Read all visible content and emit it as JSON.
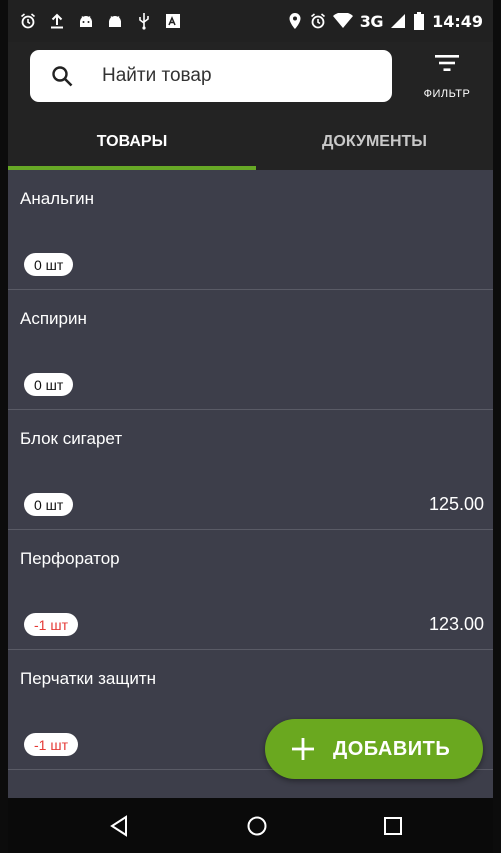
{
  "status_bar": {
    "network": "3G",
    "time": "14:49",
    "left_icons": [
      "alarm-icon",
      "upload-icon",
      "android-icon",
      "android-icon",
      "usb-icon",
      "image-icon"
    ],
    "right_icons": [
      "location-icon",
      "alarm-icon",
      "wifi-icon",
      "network-label",
      "signal-icon",
      "battery-icon",
      "time"
    ]
  },
  "header": {
    "search": {
      "placeholder": "Найти товар",
      "value": ""
    },
    "filter_label": "ФИЛЬТР"
  },
  "tabs": [
    {
      "label": "ТОВАРЫ",
      "active": true
    },
    {
      "label": "ДОКУМЕНТЫ",
      "active": false
    }
  ],
  "products": [
    {
      "name": "Анальгин",
      "qty": "0 шт",
      "price": ""
    },
    {
      "name": "Аспирин",
      "qty": "0 шт",
      "price": ""
    },
    {
      "name": "Блок сигарет",
      "qty": "0 шт",
      "price": "125.00"
    },
    {
      "name": "Перфоратор",
      "qty": "-1 шт",
      "price": "123.00"
    },
    {
      "name": "Перчатки защитн",
      "qty": "-1 шт",
      "price": ""
    }
  ],
  "add_button": {
    "label": "ДОБАВИТЬ"
  },
  "colors": {
    "accent": "#6aa81f",
    "header_bg": "#232323",
    "list_bg": "#3d3e4a",
    "negative": "#e53935"
  },
  "nav_bar": {
    "icons": [
      "back-icon",
      "home-icon",
      "recents-icon"
    ]
  }
}
